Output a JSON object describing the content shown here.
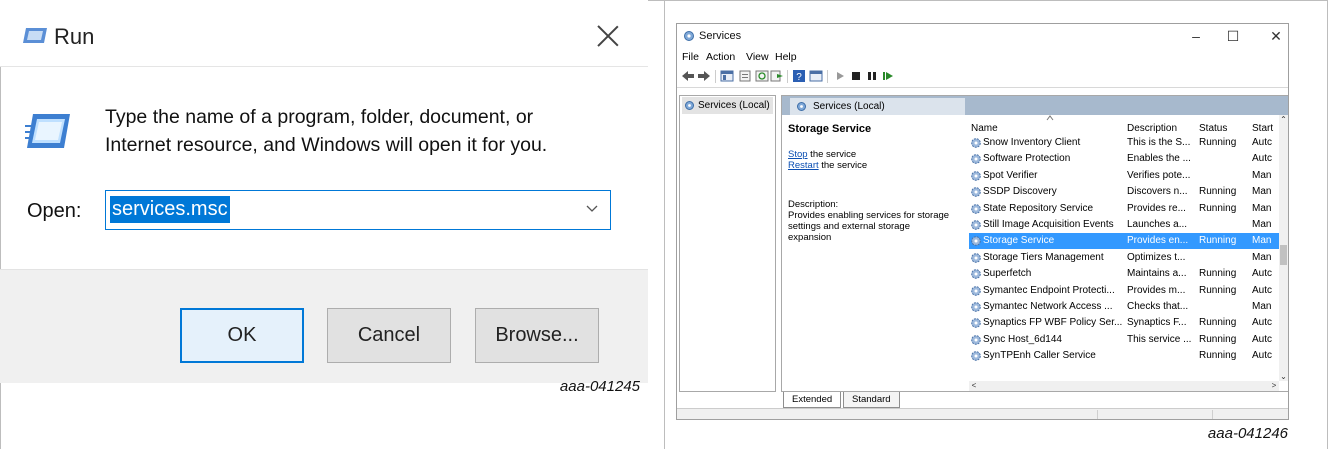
{
  "run_dialog": {
    "title": "Run",
    "title_icon": "run-icon",
    "message_line1": "Type the name of a program, folder, document, or",
    "message_line2": "Internet resource, and Windows will open it for you.",
    "open_label": "Open:",
    "open_value": "services.msc",
    "buttons": {
      "ok": "OK",
      "cancel": "Cancel",
      "browse": "Browse..."
    },
    "figure_code": "aaa-041245",
    "colors": {
      "accent": "#0078d7",
      "footer": "#f0f0f0"
    }
  },
  "services_window": {
    "title": "Services",
    "controls": {
      "minimize": "–",
      "maximize": "☐",
      "close": "✕"
    },
    "menu": [
      "File",
      "Action",
      "View",
      "Help"
    ],
    "tree_item": "Services (Local)",
    "header_tab": "Services (Local)",
    "detail": {
      "title": "Storage Service",
      "stop_link": "Stop",
      "stop_rest": " the service",
      "restart_link": "Restart",
      "restart_rest": " the service",
      "desc_label": "Description:",
      "desc_line1": "Provides enabling services for storage",
      "desc_line2": "settings and external storage",
      "desc_line3": "expansion"
    },
    "columns": {
      "name": "Name",
      "description": "Description",
      "status": "Status",
      "startup": "Start"
    },
    "rows": [
      {
        "name": "Snow Inventory Client",
        "description": "This is the S...",
        "status": "Running",
        "startup": "Autc"
      },
      {
        "name": "Software Protection",
        "description": "Enables the ...",
        "status": "",
        "startup": "Autc"
      },
      {
        "name": "Spot Verifier",
        "description": "Verifies pote...",
        "status": "",
        "startup": "Man"
      },
      {
        "name": "SSDP Discovery",
        "description": "Discovers n...",
        "status": "Running",
        "startup": "Man"
      },
      {
        "name": "State Repository Service",
        "description": "Provides re...",
        "status": "Running",
        "startup": "Man"
      },
      {
        "name": "Still Image Acquisition Events",
        "description": "Launches a...",
        "status": "",
        "startup": "Man"
      },
      {
        "name": "Storage Service",
        "description": "Provides en...",
        "status": "Running",
        "startup": "Man",
        "selected": true
      },
      {
        "name": "Storage Tiers Management",
        "description": "Optimizes t...",
        "status": "",
        "startup": "Man"
      },
      {
        "name": "Superfetch",
        "description": "Maintains a...",
        "status": "Running",
        "startup": "Autc"
      },
      {
        "name": "Symantec Endpoint Protecti...",
        "description": "Provides m...",
        "status": "Running",
        "startup": "Autc"
      },
      {
        "name": "Symantec Network Access ...",
        "description": "Checks that...",
        "status": "",
        "startup": "Man"
      },
      {
        "name": "Synaptics FP WBF Policy Ser...",
        "description": "Synaptics F...",
        "status": "Running",
        "startup": "Autc"
      },
      {
        "name": "Sync Host_6d144",
        "description": "This service ...",
        "status": "Running",
        "startup": "Autc"
      },
      {
        "name": "SynTPEnh Caller Service",
        "description": "",
        "status": "Running",
        "startup": "Autc"
      }
    ],
    "tabs": [
      "Extended",
      "Standard"
    ],
    "figure_code": "aaa-041246",
    "colors": {
      "selection": "#3399ff",
      "header": "#a7b9cd"
    }
  }
}
